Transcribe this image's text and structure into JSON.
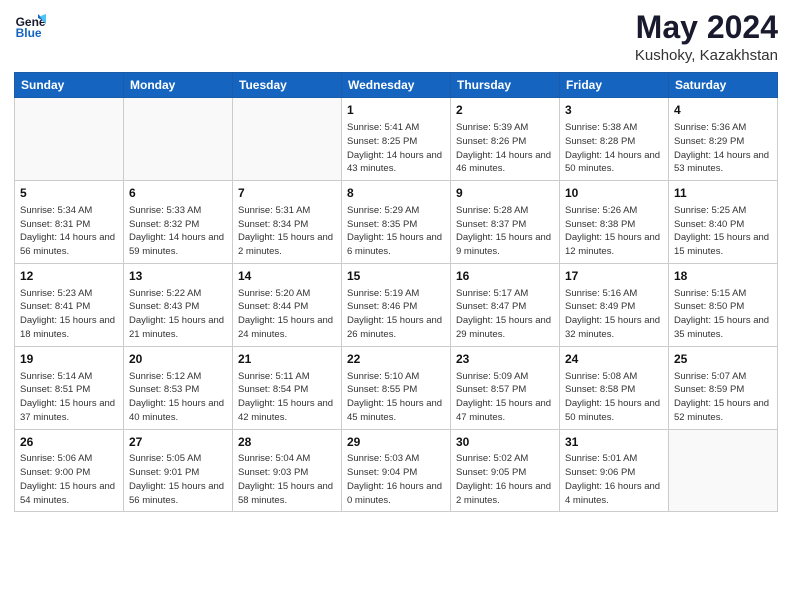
{
  "header": {
    "logo_line1": "General",
    "logo_line2": "Blue",
    "month_year": "May 2024",
    "location": "Kushoky, Kazakhstan"
  },
  "weekdays": [
    "Sunday",
    "Monday",
    "Tuesday",
    "Wednesday",
    "Thursday",
    "Friday",
    "Saturday"
  ],
  "weeks": [
    [
      {
        "day": "",
        "sunrise": "",
        "sunset": "",
        "daylight": ""
      },
      {
        "day": "",
        "sunrise": "",
        "sunset": "",
        "daylight": ""
      },
      {
        "day": "",
        "sunrise": "",
        "sunset": "",
        "daylight": ""
      },
      {
        "day": "1",
        "sunrise": "Sunrise: 5:41 AM",
        "sunset": "Sunset: 8:25 PM",
        "daylight": "Daylight: 14 hours and 43 minutes."
      },
      {
        "day": "2",
        "sunrise": "Sunrise: 5:39 AM",
        "sunset": "Sunset: 8:26 PM",
        "daylight": "Daylight: 14 hours and 46 minutes."
      },
      {
        "day": "3",
        "sunrise": "Sunrise: 5:38 AM",
        "sunset": "Sunset: 8:28 PM",
        "daylight": "Daylight: 14 hours and 50 minutes."
      },
      {
        "day": "4",
        "sunrise": "Sunrise: 5:36 AM",
        "sunset": "Sunset: 8:29 PM",
        "daylight": "Daylight: 14 hours and 53 minutes."
      }
    ],
    [
      {
        "day": "5",
        "sunrise": "Sunrise: 5:34 AM",
        "sunset": "Sunset: 8:31 PM",
        "daylight": "Daylight: 14 hours and 56 minutes."
      },
      {
        "day": "6",
        "sunrise": "Sunrise: 5:33 AM",
        "sunset": "Sunset: 8:32 PM",
        "daylight": "Daylight: 14 hours and 59 minutes."
      },
      {
        "day": "7",
        "sunrise": "Sunrise: 5:31 AM",
        "sunset": "Sunset: 8:34 PM",
        "daylight": "Daylight: 15 hours and 2 minutes."
      },
      {
        "day": "8",
        "sunrise": "Sunrise: 5:29 AM",
        "sunset": "Sunset: 8:35 PM",
        "daylight": "Daylight: 15 hours and 6 minutes."
      },
      {
        "day": "9",
        "sunrise": "Sunrise: 5:28 AM",
        "sunset": "Sunset: 8:37 PM",
        "daylight": "Daylight: 15 hours and 9 minutes."
      },
      {
        "day": "10",
        "sunrise": "Sunrise: 5:26 AM",
        "sunset": "Sunset: 8:38 PM",
        "daylight": "Daylight: 15 hours and 12 minutes."
      },
      {
        "day": "11",
        "sunrise": "Sunrise: 5:25 AM",
        "sunset": "Sunset: 8:40 PM",
        "daylight": "Daylight: 15 hours and 15 minutes."
      }
    ],
    [
      {
        "day": "12",
        "sunrise": "Sunrise: 5:23 AM",
        "sunset": "Sunset: 8:41 PM",
        "daylight": "Daylight: 15 hours and 18 minutes."
      },
      {
        "day": "13",
        "sunrise": "Sunrise: 5:22 AM",
        "sunset": "Sunset: 8:43 PM",
        "daylight": "Daylight: 15 hours and 21 minutes."
      },
      {
        "day": "14",
        "sunrise": "Sunrise: 5:20 AM",
        "sunset": "Sunset: 8:44 PM",
        "daylight": "Daylight: 15 hours and 24 minutes."
      },
      {
        "day": "15",
        "sunrise": "Sunrise: 5:19 AM",
        "sunset": "Sunset: 8:46 PM",
        "daylight": "Daylight: 15 hours and 26 minutes."
      },
      {
        "day": "16",
        "sunrise": "Sunrise: 5:17 AM",
        "sunset": "Sunset: 8:47 PM",
        "daylight": "Daylight: 15 hours and 29 minutes."
      },
      {
        "day": "17",
        "sunrise": "Sunrise: 5:16 AM",
        "sunset": "Sunset: 8:49 PM",
        "daylight": "Daylight: 15 hours and 32 minutes."
      },
      {
        "day": "18",
        "sunrise": "Sunrise: 5:15 AM",
        "sunset": "Sunset: 8:50 PM",
        "daylight": "Daylight: 15 hours and 35 minutes."
      }
    ],
    [
      {
        "day": "19",
        "sunrise": "Sunrise: 5:14 AM",
        "sunset": "Sunset: 8:51 PM",
        "daylight": "Daylight: 15 hours and 37 minutes."
      },
      {
        "day": "20",
        "sunrise": "Sunrise: 5:12 AM",
        "sunset": "Sunset: 8:53 PM",
        "daylight": "Daylight: 15 hours and 40 minutes."
      },
      {
        "day": "21",
        "sunrise": "Sunrise: 5:11 AM",
        "sunset": "Sunset: 8:54 PM",
        "daylight": "Daylight: 15 hours and 42 minutes."
      },
      {
        "day": "22",
        "sunrise": "Sunrise: 5:10 AM",
        "sunset": "Sunset: 8:55 PM",
        "daylight": "Daylight: 15 hours and 45 minutes."
      },
      {
        "day": "23",
        "sunrise": "Sunrise: 5:09 AM",
        "sunset": "Sunset: 8:57 PM",
        "daylight": "Daylight: 15 hours and 47 minutes."
      },
      {
        "day": "24",
        "sunrise": "Sunrise: 5:08 AM",
        "sunset": "Sunset: 8:58 PM",
        "daylight": "Daylight: 15 hours and 50 minutes."
      },
      {
        "day": "25",
        "sunrise": "Sunrise: 5:07 AM",
        "sunset": "Sunset: 8:59 PM",
        "daylight": "Daylight: 15 hours and 52 minutes."
      }
    ],
    [
      {
        "day": "26",
        "sunrise": "Sunrise: 5:06 AM",
        "sunset": "Sunset: 9:00 PM",
        "daylight": "Daylight: 15 hours and 54 minutes."
      },
      {
        "day": "27",
        "sunrise": "Sunrise: 5:05 AM",
        "sunset": "Sunset: 9:01 PM",
        "daylight": "Daylight: 15 hours and 56 minutes."
      },
      {
        "day": "28",
        "sunrise": "Sunrise: 5:04 AM",
        "sunset": "Sunset: 9:03 PM",
        "daylight": "Daylight: 15 hours and 58 minutes."
      },
      {
        "day": "29",
        "sunrise": "Sunrise: 5:03 AM",
        "sunset": "Sunset: 9:04 PM",
        "daylight": "Daylight: 16 hours and 0 minutes."
      },
      {
        "day": "30",
        "sunrise": "Sunrise: 5:02 AM",
        "sunset": "Sunset: 9:05 PM",
        "daylight": "Daylight: 16 hours and 2 minutes."
      },
      {
        "day": "31",
        "sunrise": "Sunrise: 5:01 AM",
        "sunset": "Sunset: 9:06 PM",
        "daylight": "Daylight: 16 hours and 4 minutes."
      },
      {
        "day": "",
        "sunrise": "",
        "sunset": "",
        "daylight": ""
      }
    ]
  ]
}
